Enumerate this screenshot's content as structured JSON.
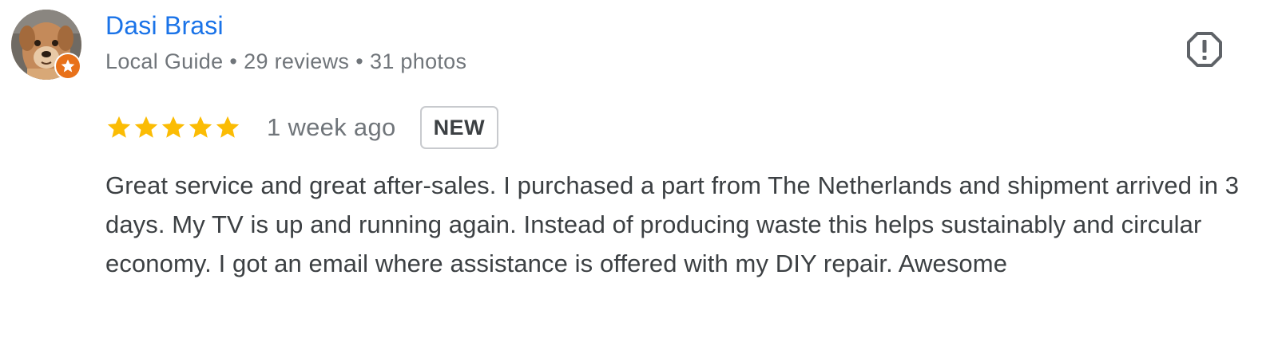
{
  "author": {
    "name": "Dasi Brasi",
    "role": "Local Guide",
    "reviews": "29 reviews",
    "photos": "31 photos",
    "separator": "•",
    "avatar_icon": "dog-avatar-photo",
    "badge_icon": "local-guide-star-icon"
  },
  "actions": {
    "report_icon": "report-icon"
  },
  "review": {
    "rating": 5,
    "rating_max": 5,
    "date": "1 week ago",
    "badge": "NEW",
    "text": "Great service and great after-sales. I purchased a part from The Netherlands and shipment arrived in 3 days. My TV is up and running again. Instead of producing waste this helps sustainably and circular economy. I got an email where assistance is offered with my DIY repair. Awesome"
  },
  "colors": {
    "name_link": "#1a73e8",
    "meta_text": "#70757a",
    "body_text": "#3c4043",
    "star": "#fbbc04",
    "badge_orange": "#e8711a",
    "badge_border": "#c8cace"
  }
}
